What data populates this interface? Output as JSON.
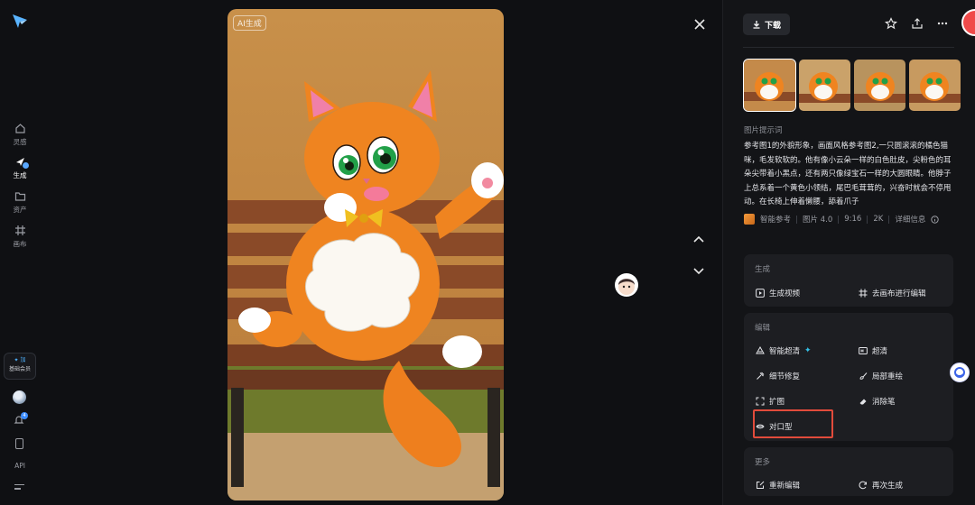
{
  "sidebar": {
    "items": [
      {
        "label": "灵感",
        "icon": "lightbulb-icon"
      },
      {
        "label": "生成",
        "icon": "generate-icon"
      },
      {
        "label": "资产",
        "icon": "folder-icon"
      },
      {
        "label": "画布",
        "icon": "canvas-icon"
      }
    ],
    "member": {
      "plus": "✦ 加",
      "label": "基础会员"
    },
    "notification_count": "4",
    "api_label": "API"
  },
  "viewer": {
    "ai_tag": "AI生成",
    "image_subject": "orange-cartoon-cat-on-bench"
  },
  "toolbar": {
    "download_label": "下载",
    "icons": [
      "star-icon",
      "share-icon",
      "more-icon"
    ]
  },
  "thumbnails": [
    {
      "selected": true
    },
    {
      "selected": false
    },
    {
      "selected": false
    },
    {
      "selected": false
    }
  ],
  "prompt": {
    "title": "图片提示词",
    "text": "参考图1的外貌形象，画面风格参考图2,一只圆滚滚的橘色猫咪，毛发软软的。他有像小云朵一样的白色肚皮，尖粉色的耳朵尖带着小黑点，还有两只像绿宝石一样的大圆眼睛。他脖子上总系着一个黄色小领结，尾巴毛茸茸的，兴奋时就会不停甩动。在长椅上伸着懒腰，舔着爪子"
  },
  "meta": {
    "reference": "智能参考",
    "model": "图片 4.0",
    "ratio": "9:16",
    "resolution": "2K",
    "details": "详细信息"
  },
  "sections": {
    "generate": {
      "title": "生成",
      "actions": [
        {
          "label": "生成视频",
          "icon": "play-icon"
        },
        {
          "label": "去画布进行编辑",
          "icon": "canvas-edit-icon"
        }
      ]
    },
    "edit": {
      "title": "编辑",
      "actions": [
        {
          "label": "智能超清",
          "icon": "hd-icon",
          "badge": "✦"
        },
        {
          "label": "超清",
          "icon": "hd-box-icon"
        },
        {
          "label": "细节修复",
          "icon": "repair-icon"
        },
        {
          "label": "局部重绘",
          "icon": "brush-icon"
        },
        {
          "label": "扩图",
          "icon": "expand-icon"
        },
        {
          "label": "消除笔",
          "icon": "eraser-icon"
        },
        {
          "label": "对口型",
          "icon": "lip-sync-icon"
        }
      ]
    },
    "more": {
      "title": "更多",
      "actions": [
        {
          "label": "重新编辑",
          "icon": "re-edit-icon"
        },
        {
          "label": "再次生成",
          "icon": "regenerate-icon"
        }
      ]
    }
  },
  "colors": {
    "accent": "#34c2e8",
    "highlight": "#e24b3b",
    "panel_bg": "#131417",
    "card_bg": "#1d1e22"
  }
}
